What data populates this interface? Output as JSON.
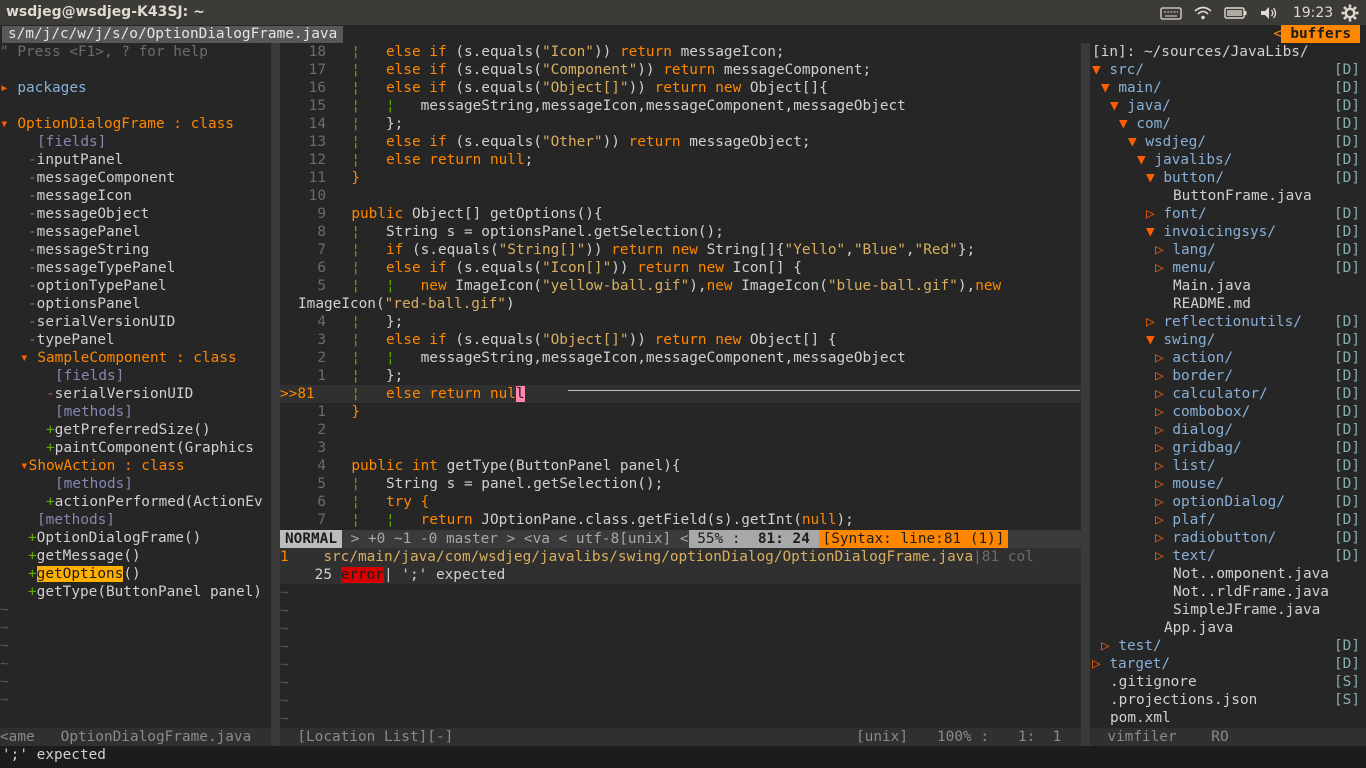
{
  "sysbar": {
    "title": "wsdjeg@wsdjeg-K43SJ: ~",
    "time": "19:23",
    "icons": [
      "keyboard-icon",
      "wifi-icon",
      "battery-icon",
      "volume-icon",
      "gear-icon"
    ]
  },
  "tabline": {
    "current_tab": "s/m/j/c/w/j/s/o/OptionDialogFrame.java",
    "buffers_label": "buffers",
    "buffers_arrow": "<"
  },
  "tagbar": {
    "help": "\" Press <F1>, ? for help",
    "packages": "packages",
    "class_name": "OptionDialogFrame",
    "class_kind": " : class",
    "fields_label": "[fields]",
    "fields": [
      "inputPanel",
      "messageComponent",
      "messageIcon",
      "messageObject",
      "messagePanel",
      "messageString",
      "messageTypePanel",
      "optionTypePanel",
      "optionsPanel",
      "serialVersionUID",
      "typePanel"
    ],
    "sample_class": "SampleComponent",
    "sample_fields_label": "[fields]",
    "sample_field": "serialVersionUID",
    "sample_methods_label": "[methods]",
    "sample_methods": [
      "getPreferredSize()",
      "paintComponent(Graphics"
    ],
    "show_class": "ShowAction",
    "show_methods_label": "[methods]",
    "show_method": "actionPerformed(ActionEv",
    "methods_label": "[methods]",
    "methods": [
      "OptionDialogFrame()",
      "getMessage()",
      "getOptions",
      "()",
      "getType(ButtonPanel panel)"
    ],
    "status_left": "<ame",
    "status_name": "OptionDialogFrame.java"
  },
  "editor": {
    "gutter": [
      "18",
      "17",
      "16",
      "15",
      "14",
      "13",
      "12",
      "11",
      "10",
      "9",
      "8",
      "7",
      "6",
      "5",
      "",
      "4",
      "3",
      "2",
      "1",
      ">>81",
      "1",
      "2",
      "3",
      "4",
      "5",
      "6",
      "7"
    ],
    "t": {
      "l1a": "else if",
      "l1b": "(s.equals(",
      "l1c": "\"Icon\"",
      "l1d": ")) ",
      "l1e": "return",
      "l1f": " messageIcon;",
      "l2a": "else if",
      "l2b": "(s.equals(",
      "l2c": "\"Component\"",
      "l2d": ")) ",
      "l2e": "return",
      "l2f": " messageComponent;",
      "l3a": "else if",
      "l3b": "(s.equals(",
      "l3c": "\"Object[]\"",
      "l3d": ")) ",
      "l3e": "return new",
      "l3f": " Object[]{",
      "l4": "messageString,messageIcon,messageComponent,messageObject",
      "l5": "};",
      "l6a": "else if",
      "l6b": "(s.equals(",
      "l6c": "\"Other\"",
      "l6d": ")) ",
      "l6e": "return",
      "l6f": " messageObject;",
      "l7a": "else return",
      "l7b": " null",
      ";": ";",
      "l8": "}",
      "l10a": "public",
      "l10b": " Object[] getOptions(){",
      "l11": "String s = optionsPanel.getSelection();",
      "l12a": "if",
      "l12b": " (s.equals(",
      "l12c": "\"String[]\"",
      "l12d": ")) ",
      "l12e": "return new",
      "l12f": " String[]{",
      "l12g": "\"Yello\"",
      "l12h": ",",
      "l12i": "\"Blue\"",
      "l12j": ",",
      "l12k": "\"Red\"",
      "l12l": "};",
      "l13a": "else if",
      "l13b": " (s.equals(",
      "l13c": "\"Icon[]\"",
      "l13d": ")) ",
      "l13e": "return new",
      "l13f": " Icon[] {",
      "l14a": "new",
      "l14b": " ImageIcon(",
      "l14c": "\"yellow-ball.gif\"",
      "l14d": "),",
      "l14e": "new",
      "l14f": " ImageIcon(",
      "l14g": "\"blue-ball.gif\"",
      "l14h": "),",
      "l14i": "new",
      "l15a": "ImageIcon(",
      "l15b": "\"red-ball.gif\"",
      "l15c": ")",
      "l16": "};",
      "l17a": "else if",
      "l17b": " (s.equals(",
      "l17c": "\"Object[]\"",
      "l17d": ")) ",
      "l17e": "return new",
      "l17f": " Object[] {",
      "l18": "messageString,messageIcon,messageComponent,messageObject",
      "l19": "};",
      "l20a": "else return",
      "l20b": " nul",
      "l20c": "l",
      "l21": "}",
      "l24a": "public int",
      "l24b": " getType(ButtonPanel panel){",
      "l25": "String s = panel.getSelection();",
      "l26a": "try",
      "l26b": " {",
      "l27a": "return",
      "l27b": " JOptionPane.class.getField(s).getInt(",
      "l27c": "null",
      ");": ");"
    }
  },
  "statusline": {
    "mode": "NORMAL",
    "git": " > +0 ~1 -0 master ",
    "va": "> <va ",
    "enc": "< utf-8[unix] <",
    "percent": " 55% : ",
    "pos": " 81: 24 ",
    "syntax": "[Syntax: line:81 (1)]"
  },
  "loclist": {
    "row1_num": "1",
    "row1_path": "src/main/java/com/wsdjeg/javalibs/swing/optionDialog/OptionDialogFrame.java",
    "row1_col": "|81 col",
    "row2_num": "25",
    "row2_tag": "error",
    "row2_msg": "| ';' expected",
    "status_name": "[Location List][-]",
    "status_ff": "[unix]",
    "status_pct": "100% :",
    "status_pos": "1:  1"
  },
  "vimfiler": {
    "header": "[in]: ~/sources/JavaLibs/",
    "status_name": "vimfiler",
    "status_ro": "RO",
    "rows": [
      {
        "indent": 0,
        "arrow": "▼",
        "name": "src/",
        "tag": "[D]",
        "type": "dir"
      },
      {
        "indent": 1,
        "arrow": "▼",
        "name": "main/",
        "tag": "[D]",
        "type": "dir"
      },
      {
        "indent": 2,
        "arrow": "▼",
        "name": "java/",
        "tag": "[D]",
        "type": "dir"
      },
      {
        "indent": 3,
        "arrow": "▼",
        "name": "com/",
        "tag": "[D]",
        "type": "dir"
      },
      {
        "indent": 4,
        "arrow": "▼",
        "name": "wsdjeg/",
        "tag": "[D]",
        "type": "dir"
      },
      {
        "indent": 5,
        "arrow": "▼",
        "name": "javalibs/",
        "tag": "[D]",
        "type": "dir"
      },
      {
        "indent": 6,
        "arrow": "▼",
        "name": "button/",
        "tag": "[D]",
        "type": "dir"
      },
      {
        "indent": 7,
        "arrow": "",
        "name": "ButtonFrame.java",
        "tag": "",
        "type": "file"
      },
      {
        "indent": 6,
        "arrow": "▷",
        "name": "font/",
        "tag": "[D]",
        "type": "dir"
      },
      {
        "indent": 6,
        "arrow": "▼",
        "name": "invoicingsys/",
        "tag": "[D]",
        "type": "dir"
      },
      {
        "indent": 7,
        "arrow": "▷",
        "name": "lang/",
        "tag": "[D]",
        "type": "dir"
      },
      {
        "indent": 7,
        "arrow": "▷",
        "name": "menu/",
        "tag": "[D]",
        "type": "dir"
      },
      {
        "indent": 7,
        "arrow": "",
        "name": "Main.java",
        "tag": "",
        "type": "file"
      },
      {
        "indent": 7,
        "arrow": "",
        "name": "README.md",
        "tag": "",
        "type": "file"
      },
      {
        "indent": 6,
        "arrow": "▷",
        "name": "reflectionutils/",
        "tag": "[D]",
        "type": "dir"
      },
      {
        "indent": 6,
        "arrow": "▼",
        "name": "swing/",
        "tag": "[D]",
        "type": "dir"
      },
      {
        "indent": 7,
        "arrow": "▷",
        "name": "action/",
        "tag": "[D]",
        "type": "dir"
      },
      {
        "indent": 7,
        "arrow": "▷",
        "name": "border/",
        "tag": "[D]",
        "type": "dir"
      },
      {
        "indent": 7,
        "arrow": "▷",
        "name": "calculator/",
        "tag": "[D]",
        "type": "dir"
      },
      {
        "indent": 7,
        "arrow": "▷",
        "name": "combobox/",
        "tag": "[D]",
        "type": "dir"
      },
      {
        "indent": 7,
        "arrow": "▷",
        "name": "dialog/",
        "tag": "[D]",
        "type": "dir"
      },
      {
        "indent": 7,
        "arrow": "▷",
        "name": "gridbag/",
        "tag": "[D]",
        "type": "dir"
      },
      {
        "indent": 7,
        "arrow": "▷",
        "name": "list/",
        "tag": "[D]",
        "type": "dir"
      },
      {
        "indent": 7,
        "arrow": "▷",
        "name": "mouse/",
        "tag": "[D]",
        "type": "dir"
      },
      {
        "indent": 7,
        "arrow": "▷",
        "name": "optionDialog/",
        "tag": "[D]",
        "type": "dir"
      },
      {
        "indent": 7,
        "arrow": "▷",
        "name": "plaf/",
        "tag": "[D]",
        "type": "dir"
      },
      {
        "indent": 7,
        "arrow": "▷",
        "name": "radiobutton/",
        "tag": "[D]",
        "type": "dir"
      },
      {
        "indent": 7,
        "arrow": "▷",
        "name": "text/",
        "tag": "[D]",
        "type": "dir"
      },
      {
        "indent": 7,
        "arrow": "",
        "name": "Not..omponent.java",
        "tag": "",
        "type": "file"
      },
      {
        "indent": 7,
        "arrow": "",
        "name": "Not..rldFrame.java",
        "tag": "",
        "type": "file"
      },
      {
        "indent": 7,
        "arrow": "",
        "name": "SimpleJFrame.java",
        "tag": "",
        "type": "file"
      },
      {
        "indent": 6,
        "arrow": "",
        "name": "App.java",
        "tag": "",
        "type": "file"
      },
      {
        "indent": 1,
        "arrow": "▷",
        "name": "test/",
        "tag": "[D]",
        "type": "dir"
      },
      {
        "indent": 0,
        "arrow": "▷",
        "name": "target/",
        "tag": "[D]",
        "type": "dir"
      },
      {
        "indent": 0,
        "arrow": "",
        "name": ".gitignore",
        "tag": "[S]",
        "type": "file"
      },
      {
        "indent": 0,
        "arrow": "",
        "name": ".projections.json",
        "tag": "[S]",
        "type": "file"
      },
      {
        "indent": 0,
        "arrow": "",
        "name": "pom.xml",
        "tag": "",
        "type": "file"
      }
    ]
  },
  "cmdline": "';' expected",
  "colors": {
    "accent": "#ff8700",
    "keyword": "#ff8700",
    "string": "#d7af5f",
    "directory": "#87afd7",
    "error": "#d70000",
    "background": "#262626"
  }
}
